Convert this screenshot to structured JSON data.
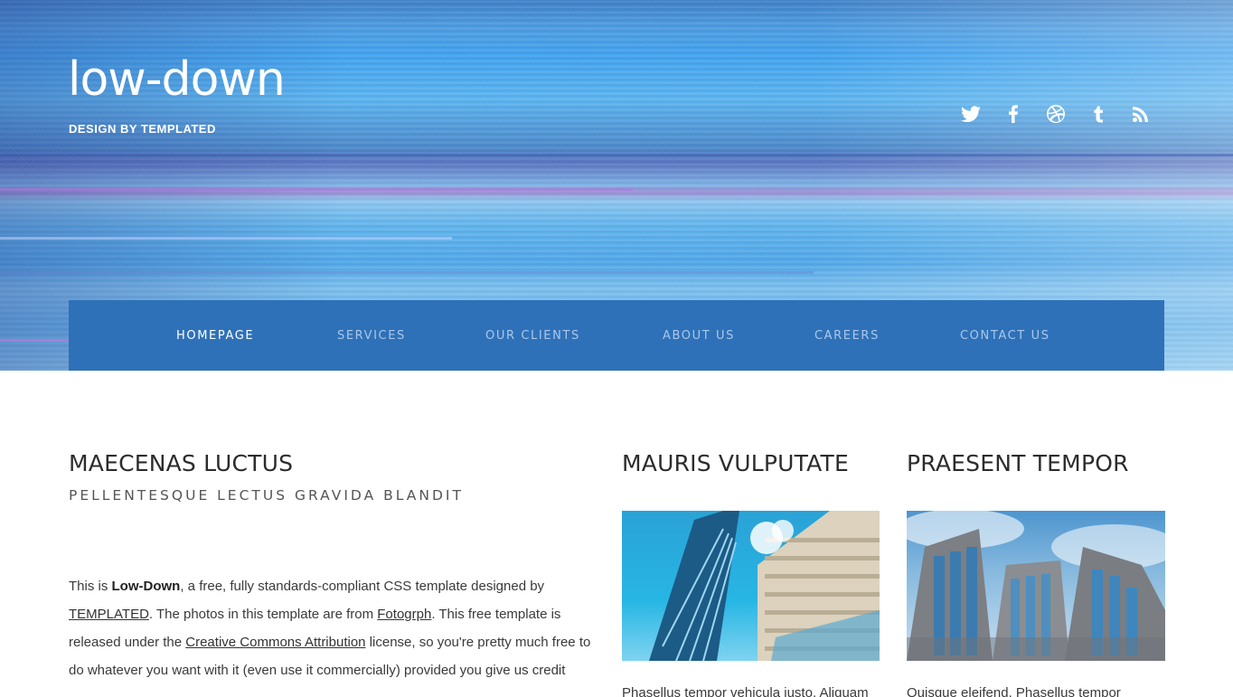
{
  "site": {
    "logo": "low-down",
    "tagline": "DESIGN BY TEMPLATED"
  },
  "social": [
    {
      "name": "twitter-icon"
    },
    {
      "name": "facebook-icon"
    },
    {
      "name": "dribbble-icon"
    },
    {
      "name": "tumblr-icon"
    },
    {
      "name": "rss-icon"
    }
  ],
  "nav": {
    "items": [
      {
        "label": "HOMEPAGE",
        "active": true
      },
      {
        "label": "SERVICES",
        "active": false
      },
      {
        "label": "OUR CLIENTS",
        "active": false
      },
      {
        "label": "ABOUT US",
        "active": false
      },
      {
        "label": "CAREERS",
        "active": false
      },
      {
        "label": "CONTACT US",
        "active": false
      }
    ]
  },
  "main": {
    "title": "MAECENAS LUCTUS",
    "subtitle": "PELLENTESQUE LECTUS GRAVIDA BLANDIT",
    "body": {
      "t1": "This is ",
      "bold": "Low-Down",
      "t2": ", a free, fully standards-compliant CSS template designed by ",
      "link1": "TEMPLATED",
      "t3": ". The photos in this template are from ",
      "link2": "Fotogrph",
      "t4": ". This free template is released under the ",
      "link3": "Creative Commons Attribution",
      "t5": " license, so you're pretty much free to do whatever you want with it (even use it commercially) provided you give us credit"
    }
  },
  "col2": {
    "title": "MAURIS VULPUTATE",
    "text": "Phasellus tempor vehicula justo. Aliquam"
  },
  "col3": {
    "title": "PRAESENT TEMPOR",
    "text": "Quisque eleifend. Phasellus tempor"
  },
  "colors": {
    "nav_bg": "#2f71b8",
    "nav_text": "#a9c8ea",
    "nav_active": "#ffffff"
  }
}
